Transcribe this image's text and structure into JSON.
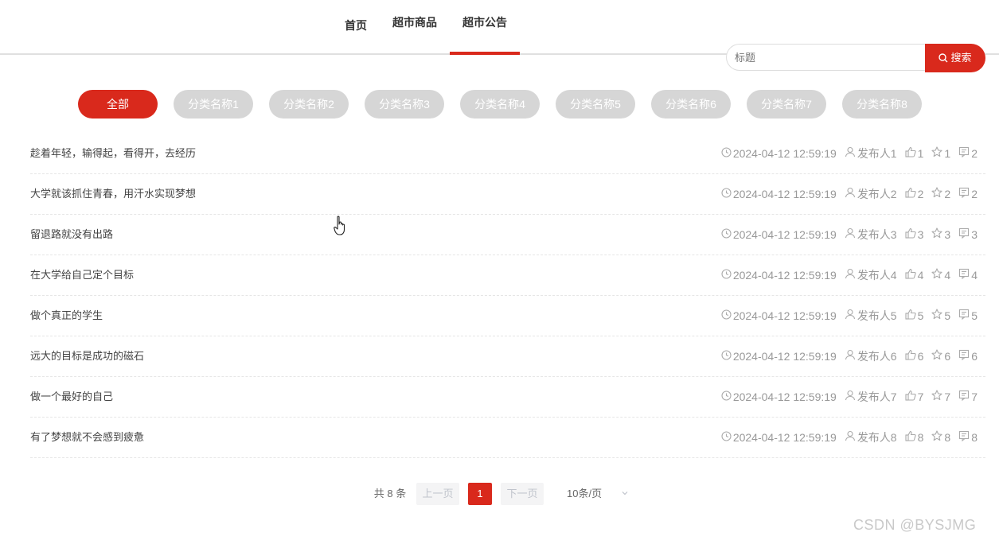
{
  "nav": {
    "items": [
      {
        "label": "首页"
      },
      {
        "label": "超市商品"
      },
      {
        "label": "超市公告"
      }
    ],
    "active_index": 2
  },
  "search": {
    "placeholder": "标题",
    "button_label": "搜索"
  },
  "categories": [
    "全部",
    "分类名称1",
    "分类名称2",
    "分类名称3",
    "分类名称4",
    "分类名称5",
    "分类名称6",
    "分类名称7",
    "分类名称8"
  ],
  "active_category": 0,
  "announcements": [
    {
      "title": "趁着年轻，输得起，看得开，去经历",
      "time": "2024-04-12 12:59:19",
      "author": "发布人1",
      "likes": "1",
      "favorites": "1",
      "comments": "2"
    },
    {
      "title": "大学就该抓住青春，用汗水实现梦想",
      "time": "2024-04-12 12:59:19",
      "author": "发布人2",
      "likes": "2",
      "favorites": "2",
      "comments": "2"
    },
    {
      "title": "留退路就没有出路",
      "time": "2024-04-12 12:59:19",
      "author": "发布人3",
      "likes": "3",
      "favorites": "3",
      "comments": "3"
    },
    {
      "title": "在大学给自己定个目标",
      "time": "2024-04-12 12:59:19",
      "author": "发布人4",
      "likes": "4",
      "favorites": "4",
      "comments": "4"
    },
    {
      "title": "做个真正的学生",
      "time": "2024-04-12 12:59:19",
      "author": "发布人5",
      "likes": "5",
      "favorites": "5",
      "comments": "5"
    },
    {
      "title": "远大的目标是成功的磁石",
      "time": "2024-04-12 12:59:19",
      "author": "发布人6",
      "likes": "6",
      "favorites": "6",
      "comments": "6"
    },
    {
      "title": "做一个最好的自己",
      "time": "2024-04-12 12:59:19",
      "author": "发布人7",
      "likes": "7",
      "favorites": "7",
      "comments": "7"
    },
    {
      "title": "有了梦想就不会感到疲惫",
      "time": "2024-04-12 12:59:19",
      "author": "发布人8",
      "likes": "8",
      "favorites": "8",
      "comments": "8"
    }
  ],
  "pagination": {
    "total_label": "共 8 条",
    "prev_label": "上一页",
    "current_page": "1",
    "next_label": "下一页",
    "page_size_label": "10条/页"
  },
  "watermark": "CSDN @BYSJMG",
  "colors": {
    "accent": "#d9291c",
    "inactive_tag": "#d6d6d6",
    "meta": "#999999"
  },
  "icons": [
    "search-icon",
    "clock-icon",
    "user-icon",
    "thumbs-up-icon",
    "star-icon",
    "comment-icon",
    "chevron-down-icon",
    "hand-pointer-cursor"
  ]
}
